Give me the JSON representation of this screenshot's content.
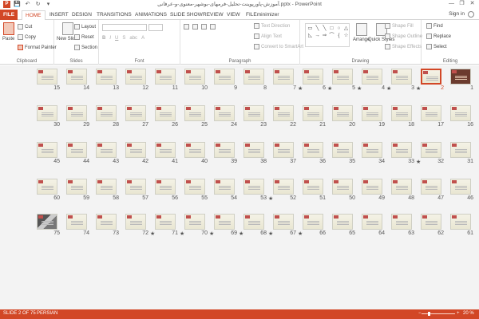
{
  "window": {
    "title": "آموزش-پاورپوینت-تحلیل-فرمهای-بوشهر-معنوی-و-عرفانی.pptx - PowerPoint",
    "minimize": "—",
    "restore": "❐",
    "close": "✕"
  },
  "qat": {
    "logo": "P",
    "save": "💾",
    "undo": "↶",
    "redo": "↻",
    "customize": "▾"
  },
  "tabs": [
    "FILE",
    "HOME",
    "INSERT",
    "DESIGN",
    "TRANSITIONS",
    "ANIMATIONS",
    "SLIDE SHOW",
    "REVIEW",
    "VIEW",
    "FILEminimizer"
  ],
  "active_tab": "HOME",
  "account": {
    "signin": "Sign in"
  },
  "ribbon": {
    "clipboard": {
      "label": "Clipboard",
      "paste": "Paste",
      "cut": "Cut",
      "copy": "Copy",
      "format_painter": "Format Painter"
    },
    "slides": {
      "label": "Slides",
      "new_slide": "New Slide",
      "layout": "Layout",
      "reset": "Reset",
      "section": "Section"
    },
    "font": {
      "label": "Font"
    },
    "paragraph": {
      "label": "Paragraph",
      "text_direction": "Text Direction",
      "align_text": "Align Text",
      "convert": "Convert to SmartArt"
    },
    "drawing": {
      "label": "Drawing",
      "arrange": "Arrange",
      "quick_styles": "Quick Styles",
      "shape_fill": "Shape Fill",
      "shape_outline": "Shape Outline",
      "shape_effects": "Shape Effects"
    },
    "editing": {
      "label": "Editing",
      "find": "Find",
      "replace": "Replace",
      "select": "Select"
    }
  },
  "slides": [
    {
      "n": "15",
      "star": false
    },
    {
      "n": "14",
      "star": false
    },
    {
      "n": "13",
      "star": false
    },
    {
      "n": "12",
      "star": false
    },
    {
      "n": "11",
      "star": false
    },
    {
      "n": "10",
      "star": false
    },
    {
      "n": "9",
      "star": false
    },
    {
      "n": "8",
      "star": false
    },
    {
      "n": "7",
      "star": false
    },
    {
      "n": "6",
      "star": true
    },
    {
      "n": "5",
      "star": true
    },
    {
      "n": "4",
      "star": true
    },
    {
      "n": "3",
      "star": true
    },
    {
      "n": "2",
      "star": true
    },
    {
      "n": "1",
      "star": false
    },
    {
      "n": "30",
      "star": false
    },
    {
      "n": "29",
      "star": false
    },
    {
      "n": "28",
      "star": false
    },
    {
      "n": "27",
      "star": false
    },
    {
      "n": "26",
      "star": false
    },
    {
      "n": "25",
      "star": false
    },
    {
      "n": "24",
      "star": false
    },
    {
      "n": "23",
      "star": false
    },
    {
      "n": "22",
      "star": false
    },
    {
      "n": "21",
      "star": false
    },
    {
      "n": "20",
      "star": false
    },
    {
      "n": "19",
      "star": false
    },
    {
      "n": "18",
      "star": false
    },
    {
      "n": "17",
      "star": false
    },
    {
      "n": "16",
      "star": false
    },
    {
      "n": "45",
      "star": false
    },
    {
      "n": "44",
      "star": false
    },
    {
      "n": "43",
      "star": false
    },
    {
      "n": "42",
      "star": false
    },
    {
      "n": "41",
      "star": false
    },
    {
      "n": "40",
      "star": false
    },
    {
      "n": "39",
      "star": false
    },
    {
      "n": "38",
      "star": false
    },
    {
      "n": "37",
      "star": false
    },
    {
      "n": "36",
      "star": false
    },
    {
      "n": "35",
      "star": false
    },
    {
      "n": "34",
      "star": false
    },
    {
      "n": "33",
      "star": false
    },
    {
      "n": "32",
      "star": true
    },
    {
      "n": "31",
      "star": false
    },
    {
      "n": "60",
      "star": false
    },
    {
      "n": "59",
      "star": false
    },
    {
      "n": "58",
      "star": false
    },
    {
      "n": "57",
      "star": false
    },
    {
      "n": "56",
      "star": false
    },
    {
      "n": "55",
      "star": false
    },
    {
      "n": "54",
      "star": false
    },
    {
      "n": "53",
      "star": false
    },
    {
      "n": "52",
      "star": true
    },
    {
      "n": "51",
      "star": false
    },
    {
      "n": "50",
      "star": false
    },
    {
      "n": "49",
      "star": false
    },
    {
      "n": "48",
      "star": false
    },
    {
      "n": "47",
      "star": false
    },
    {
      "n": "46",
      "star": false
    },
    {
      "n": "75",
      "star": false
    },
    {
      "n": "74",
      "star": false
    },
    {
      "n": "73",
      "star": false
    },
    {
      "n": "72",
      "star": false
    },
    {
      "n": "71",
      "star": true
    },
    {
      "n": "70",
      "star": true
    },
    {
      "n": "69",
      "star": true
    },
    {
      "n": "68",
      "star": true
    },
    {
      "n": "67",
      "star": true
    },
    {
      "n": "66",
      "star": true
    },
    {
      "n": "65",
      "star": false
    },
    {
      "n": "64",
      "star": false
    },
    {
      "n": "63",
      "star": false
    },
    {
      "n": "62",
      "star": false
    },
    {
      "n": "61",
      "star": false
    }
  ],
  "selected_slide": "2",
  "status": {
    "slide_info": "SLIDE 2 OF 75",
    "language": "PERSIAN",
    "zoom": "20 %",
    "zoom_minus": "−",
    "zoom_plus": "+"
  },
  "colors": {
    "accent": "#d24726",
    "sorter_bg": "#f3f3f3"
  }
}
